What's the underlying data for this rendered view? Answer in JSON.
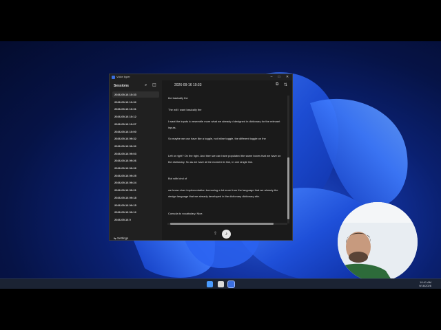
{
  "window": {
    "title": "Voice typer",
    "minimize_icon": "minimize-icon",
    "maximize_icon": "maximize-icon",
    "close_icon": "close-icon"
  },
  "sidebar": {
    "header": "Sessions",
    "search_icon": "search-icon",
    "panel_icon": "sidebar-toggle-icon",
    "sessions": [
      "2026-09-16 10:33",
      "2026-09-16 10:32",
      "2026-09-16 10:31",
      "2026-09-16 10:12",
      "2026-09-16 10:07",
      "2026-09-16 10:00",
      "2026-09-16 09:32",
      "2026-09-16 09:32",
      "2026-09-16 09:03",
      "2026-09-16 09:26",
      "2026-09-16 09:26",
      "2026-09-16 09:25",
      "2026-09-16 09:24",
      "2026-09-16 09:21",
      "2026-09-16 09:18",
      "2026-09-16 09:15",
      "2026-09-16 09:12",
      "2026-09-16 0"
    ],
    "settings_label": "Settings"
  },
  "main": {
    "title": "2026-09-16 10:33",
    "copy_icon": "copy-icon",
    "swap_icon": "swap-icon",
    "paragraphs": [
      "the basically the",
      "The will I want basically the",
      "I want the inputs to resemble more what we already d designed in dictionary for the relevant inputs.",
      "So maybe we can have like a toggle, not inline toggle, the different toggle on the",
      "Left or right? On the right. And then we can have populated the same boxes that we have on the dictionary. So as we have at the moment in line, in one single line.",
      "But with kind of",
      "we know nicer implementation borrowing a lot more from the language that we already the design language that we already developed in the dictionary dictionary site.",
      "Consola to vocabulary. Nice."
    ],
    "upload_icon": "upload-icon",
    "mic_icon": "microphone-icon"
  },
  "taskbar": {
    "time": "10:41 AM",
    "date": "9/16/2026"
  },
  "colors": {
    "accent": "#3b6fe0",
    "window_bg": "#1e1e1e",
    "sidebar_bg": "#202020",
    "active_session": "#2f2f2f"
  }
}
